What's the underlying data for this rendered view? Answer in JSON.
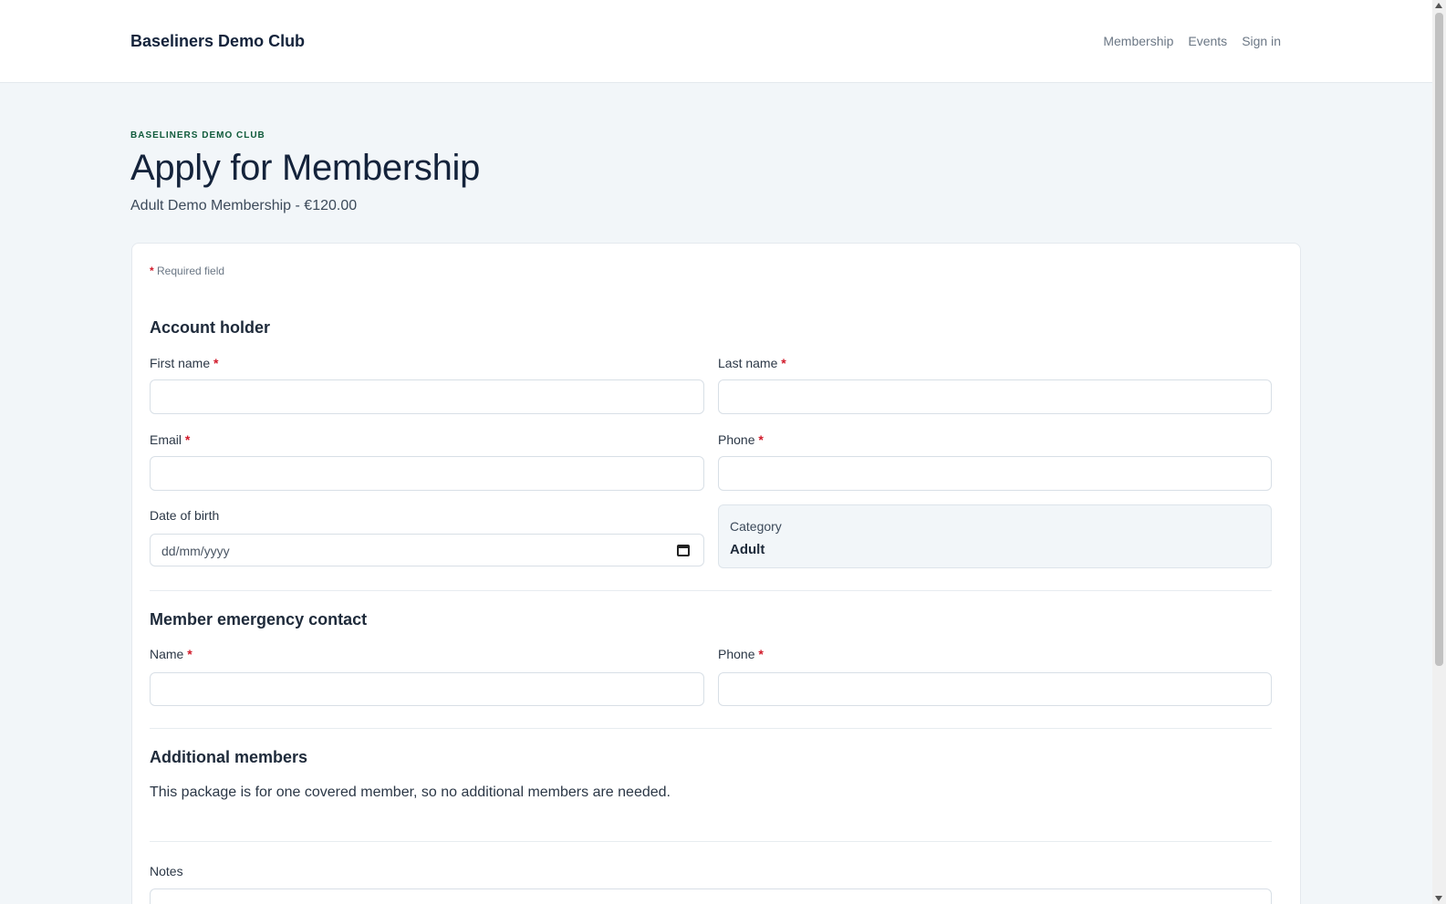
{
  "header": {
    "brand": "Baseliners Demo Club",
    "nav": [
      "Membership",
      "Events",
      "Sign in"
    ]
  },
  "page": {
    "eyebrow": "BASELINERS DEMO CLUB",
    "title": "Apply for Membership",
    "subtitle": "Adult Demo Membership - €120.00"
  },
  "form": {
    "required_note": "Required field",
    "required_marker": "*",
    "account_holder": {
      "title": "Account holder",
      "first_name": {
        "label": "First name",
        "value": ""
      },
      "last_name": {
        "label": "Last name",
        "value": ""
      },
      "email": {
        "label": "Email",
        "value": ""
      },
      "phone": {
        "label": "Phone",
        "value": ""
      },
      "dob": {
        "label": "Date of birth",
        "placeholder": "dd/mm/yyyy"
      },
      "category": {
        "label": "Category",
        "value": "Adult"
      }
    },
    "emergency": {
      "title": "Member emergency contact",
      "name": {
        "label": "Name",
        "value": ""
      },
      "phone": {
        "label": "Phone",
        "value": ""
      }
    },
    "additional": {
      "title": "Additional members",
      "text": "This package is for one covered member, so no additional members are needed."
    },
    "notes": {
      "label": "Notes"
    }
  },
  "colors": {
    "accent_green": "#0f5a3a",
    "required_red": "#d11a2a",
    "page_bg": "#f2f6f9"
  }
}
